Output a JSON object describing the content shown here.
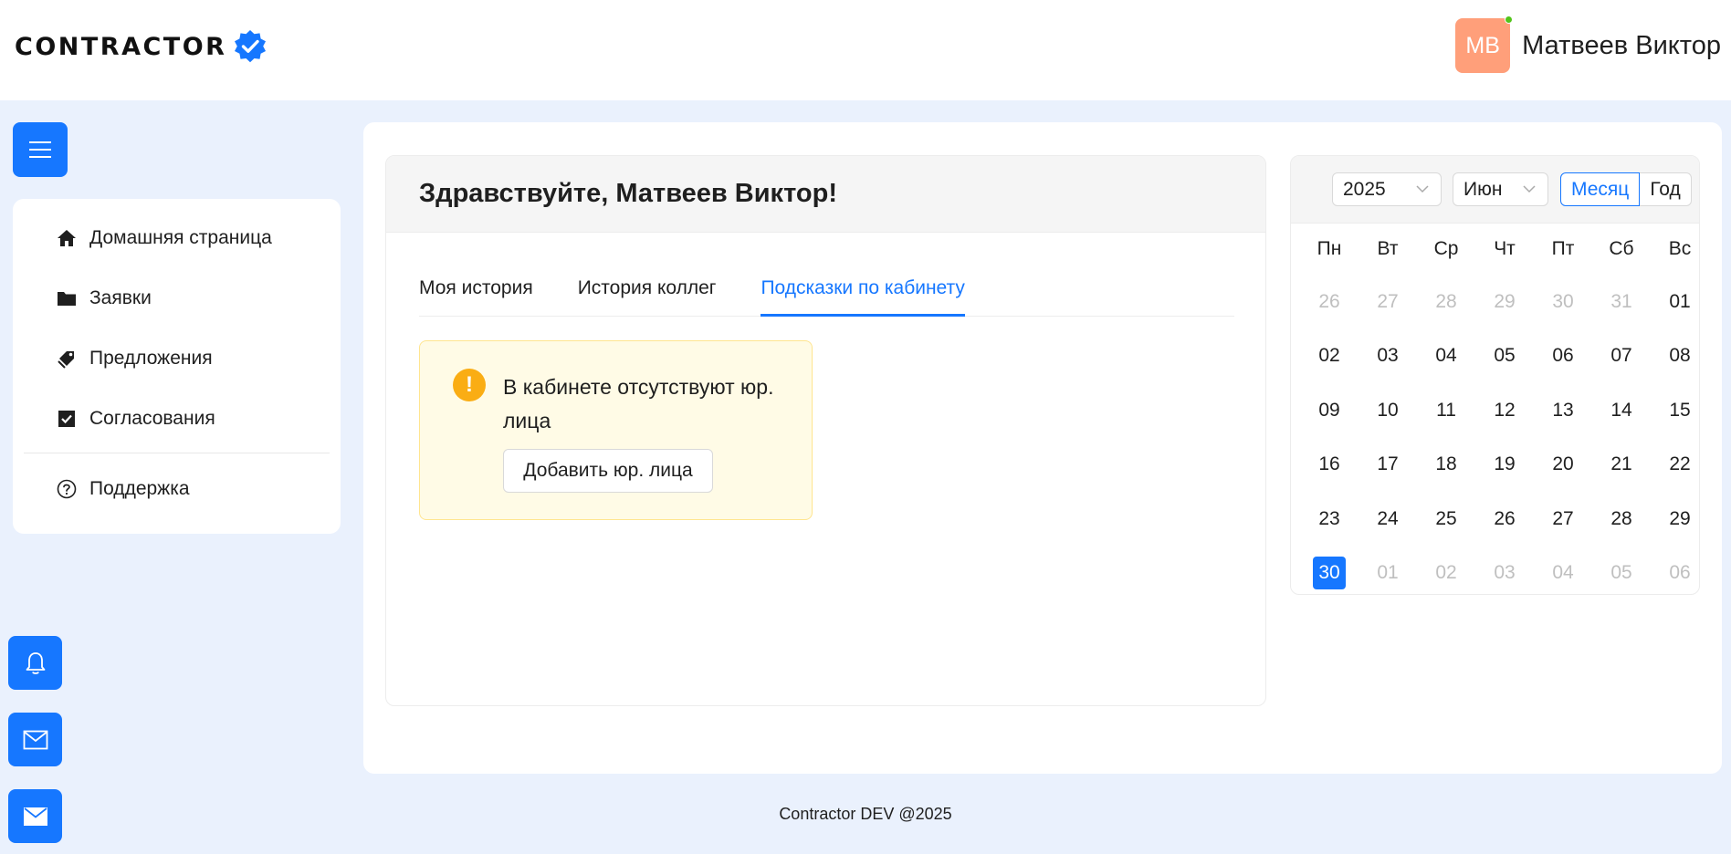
{
  "header": {
    "logo_text": "CONTRACTOR",
    "user": {
      "initials": "МВ",
      "name": "Матвеев Виктор",
      "status_color": "#52c41a",
      "avatar_color": "#ff9f7a"
    }
  },
  "sidebar": {
    "menu_icon": "hamburger-icon",
    "items": [
      {
        "label": "Домашняя страница",
        "icon": "home-icon"
      },
      {
        "label": "Заявки",
        "icon": "folder-icon"
      },
      {
        "label": "Предложения",
        "icon": "tags-icon"
      },
      {
        "label": "Согласования",
        "icon": "checkbox-icon"
      }
    ],
    "support": {
      "label": "Поддержка",
      "icon": "question-circle-icon"
    },
    "floating_buttons": [
      "bell-icon",
      "mail-outline-icon",
      "mail-filled-icon"
    ]
  },
  "main": {
    "greeting": "Здравствуйте, Матвеев Виктор!",
    "tabs": [
      {
        "label": "Моя история",
        "active": false
      },
      {
        "label": "История коллег",
        "active": false
      },
      {
        "label": "Подсказки по кабинету",
        "active": true
      }
    ],
    "alert": {
      "text": "В кабинете отсутствуют юр. лица",
      "button_label": "Добавить юр. лица"
    }
  },
  "calendar": {
    "year": "2025",
    "month": "Июн",
    "mode_month": "Месяц",
    "mode_year": "Год",
    "active_mode": "month",
    "weekdays": [
      "Пн",
      "Вт",
      "Ср",
      "Чт",
      "Пт",
      "Сб",
      "Вс"
    ],
    "weeks": [
      [
        {
          "d": "26",
          "m": true
        },
        {
          "d": "27",
          "m": true
        },
        {
          "d": "28",
          "m": true
        },
        {
          "d": "29",
          "m": true
        },
        {
          "d": "30",
          "m": true
        },
        {
          "d": "31",
          "m": true
        },
        {
          "d": "01",
          "m": false
        }
      ],
      [
        {
          "d": "02",
          "m": false
        },
        {
          "d": "03",
          "m": false
        },
        {
          "d": "04",
          "m": false
        },
        {
          "d": "05",
          "m": false
        },
        {
          "d": "06",
          "m": false
        },
        {
          "d": "07",
          "m": false
        },
        {
          "d": "08",
          "m": false
        }
      ],
      [
        {
          "d": "09",
          "m": false
        },
        {
          "d": "10",
          "m": false
        },
        {
          "d": "11",
          "m": false
        },
        {
          "d": "12",
          "m": false
        },
        {
          "d": "13",
          "m": false
        },
        {
          "d": "14",
          "m": false
        },
        {
          "d": "15",
          "m": false
        }
      ],
      [
        {
          "d": "16",
          "m": false
        },
        {
          "d": "17",
          "m": false
        },
        {
          "d": "18",
          "m": false
        },
        {
          "d": "19",
          "m": false
        },
        {
          "d": "20",
          "m": false
        },
        {
          "d": "21",
          "m": false
        },
        {
          "d": "22",
          "m": false
        }
      ],
      [
        {
          "d": "23",
          "m": false
        },
        {
          "d": "24",
          "m": false
        },
        {
          "d": "25",
          "m": false
        },
        {
          "d": "26",
          "m": false
        },
        {
          "d": "27",
          "m": false
        },
        {
          "d": "28",
          "m": false
        },
        {
          "d": "29",
          "m": false
        }
      ],
      [
        {
          "d": "30",
          "m": false,
          "today": true
        },
        {
          "d": "01",
          "m": true
        },
        {
          "d": "02",
          "m": true
        },
        {
          "d": "03",
          "m": true
        },
        {
          "d": "04",
          "m": true
        },
        {
          "d": "05",
          "m": true
        },
        {
          "d": "06",
          "m": true
        }
      ]
    ],
    "accent_color": "#1677ff"
  },
  "footer": {
    "text": "Contractor DEV @2025"
  }
}
